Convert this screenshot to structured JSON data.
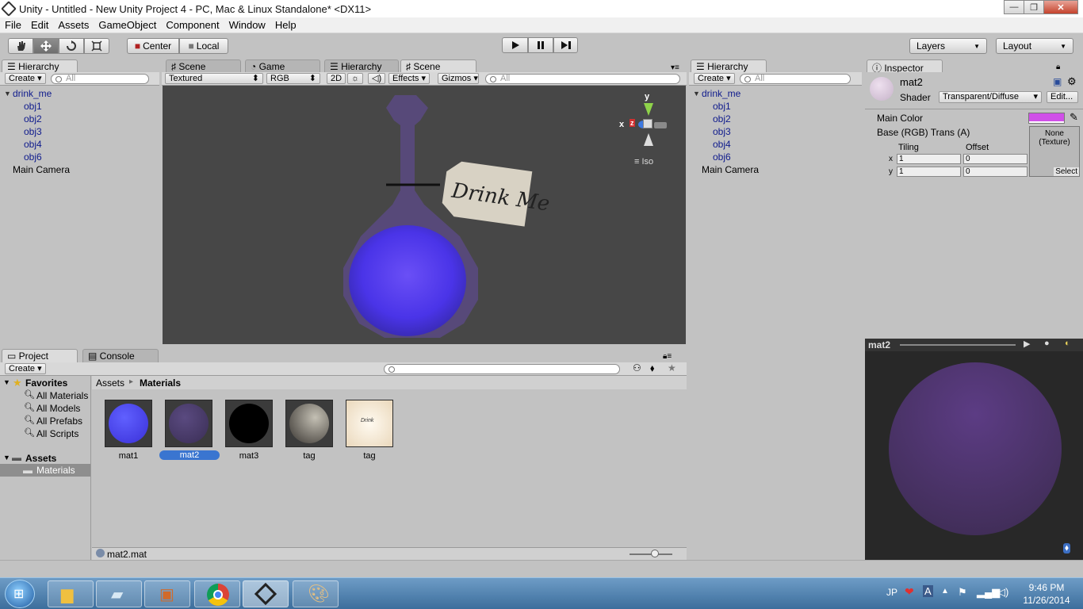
{
  "window": {
    "title": "Unity - Untitled - New Unity Project 4 - PC, Mac & Linux Standalone* <DX11>"
  },
  "menu": [
    "File",
    "Edit",
    "Assets",
    "GameObject",
    "Component",
    "Window",
    "Help"
  ],
  "toolbar": {
    "center": "Center",
    "local": "Local",
    "layers": "Layers",
    "layout": "Layout"
  },
  "tabs_left": {
    "hierarchy": "Hierarchy",
    "scene": "Scene",
    "game": "Game",
    "hierarchy2": "Hierarchy",
    "scene2": "Scene"
  },
  "hierarchy": {
    "create": "Create",
    "search_placeholder": "All",
    "items": [
      "drink_me",
      "obj1",
      "obj2",
      "obj3",
      "obj4",
      "obj6",
      "Main Camera"
    ]
  },
  "scene_bar": {
    "shading": "Textured",
    "rgb": "RGB",
    "mode2d": "2D",
    "effects": "Effects",
    "gizmos": "Gizmos",
    "search_placeholder": "All"
  },
  "scene_view": {
    "tag_text": "Drink Me",
    "gizmo_y": "y",
    "gizmo_x": "x",
    "gizmo_z": "z",
    "iso": "Iso"
  },
  "hierarchy_right": {
    "tab": "Hierarchy",
    "create": "Create",
    "search_placeholder": "All",
    "items": [
      "drink_me",
      "obj1",
      "obj2",
      "obj3",
      "obj4",
      "obj6",
      "Main Camera"
    ]
  },
  "inspector": {
    "tab": "Inspector",
    "name": "mat2",
    "shader_label": "Shader",
    "shader_value": "Transparent/Diffuse",
    "edit": "Edit...",
    "main_color": "Main Color",
    "base": "Base (RGB) Trans (A)",
    "tiling": "Tiling",
    "offset": "Offset",
    "x_label": "x",
    "y_label": "y",
    "tiling_x": "1",
    "tiling_y": "1",
    "offset_x": "0",
    "offset_y": "0",
    "texture_none": "None",
    "texture_type": "(Texture)",
    "select": "Select",
    "color_swatch": "#d050e8"
  },
  "preview": {
    "title": "mat2"
  },
  "project": {
    "tab": "Project",
    "console_tab": "Console",
    "create": "Create",
    "favorites": "Favorites",
    "fav_items": [
      "All Materials",
      "All Models",
      "All Prefabs",
      "All Scripts"
    ],
    "assets": "Assets",
    "materials": "Materials",
    "breadcrumb_root": "Assets",
    "breadcrumb_sep": "▸",
    "breadcrumb_leaf": "Materials",
    "assets_grid": [
      "mat1",
      "mat2",
      "mat3",
      "tag",
      "tag"
    ],
    "status_file": "mat2.mat"
  },
  "taskbar": {
    "lang": "JP",
    "time": "9:46 PM",
    "date": "11/26/2014"
  }
}
